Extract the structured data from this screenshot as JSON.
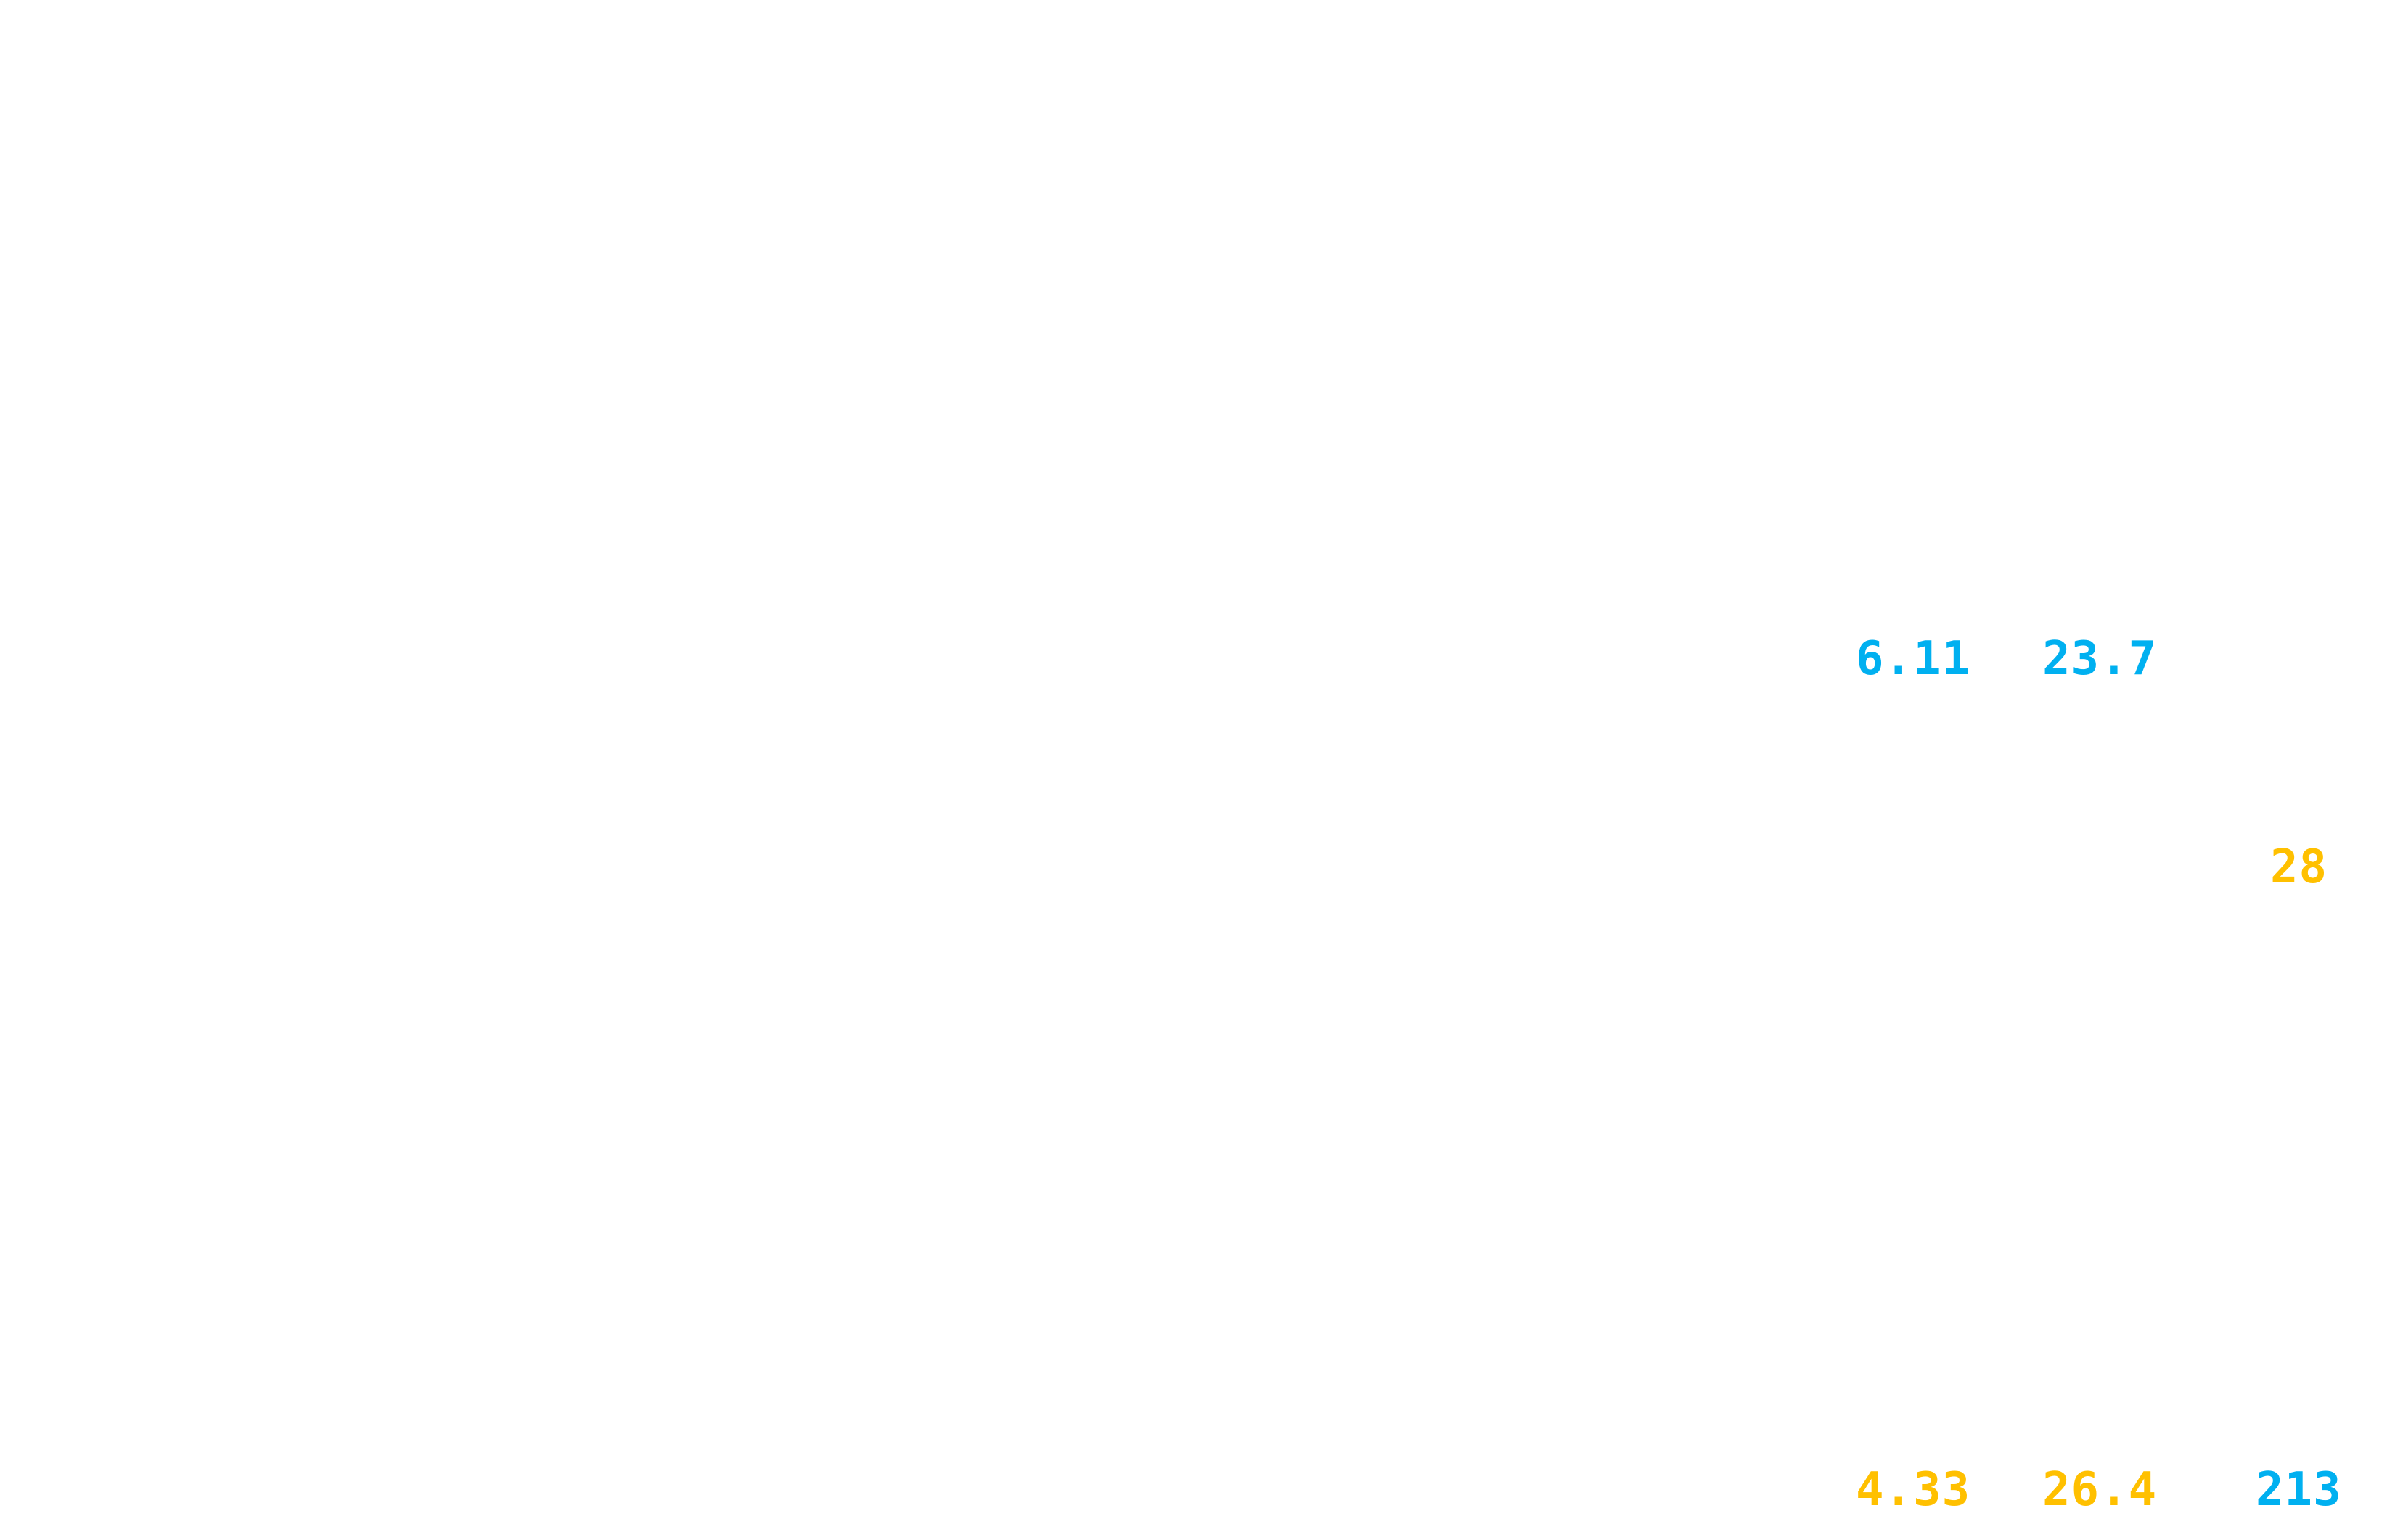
{
  "labels": [
    {
      "text": "6.11",
      "color": "#00b0f0"
    },
    {
      "text": "23.7",
      "color": "#00b0f0"
    },
    {
      "text": "28",
      "color": "#ffc000"
    },
    {
      "text": "4.33",
      "color": "#ffc000"
    },
    {
      "text": "26.4",
      "color": "#ffc000"
    },
    {
      "text": "213",
      "color": "#00b0f0"
    }
  ]
}
